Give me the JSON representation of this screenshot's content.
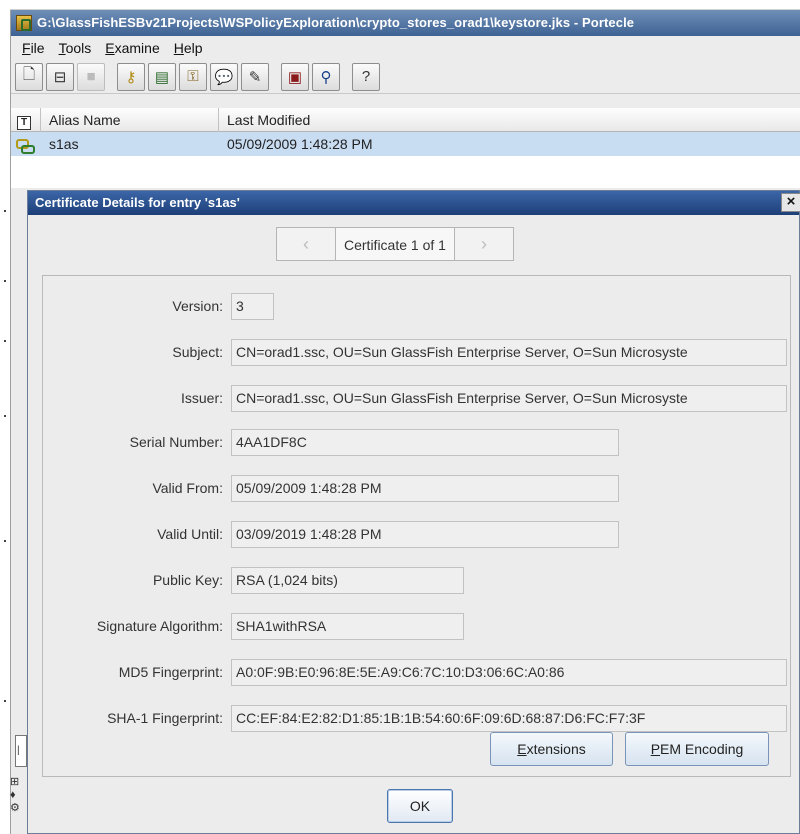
{
  "window": {
    "title": "G:\\GlassFishESBv21Projects\\WSPolicyExploration\\crypto_stores_orad1\\keystore.jks - Portecle"
  },
  "menu": [
    {
      "label": "File",
      "mnemonic": "F",
      "rest": "ile"
    },
    {
      "label": "Tools",
      "mnemonic": "T",
      "rest": "ools"
    },
    {
      "label": "Examine",
      "mnemonic": "E",
      "rest": "xamine"
    },
    {
      "label": "Help",
      "mnemonic": "H",
      "rest": "elp"
    }
  ],
  "toolbar": {
    "icons": [
      "new-keystore-icon",
      "open-keystore-icon",
      "save-keystore-icon",
      "generate-keypair-icon",
      "import-certificate-icon",
      "import-keypair-icon",
      "set-password-icon",
      "keystore-report-icon",
      "examine-certificate-icon",
      "examine-csr-icon",
      "help-icon"
    ]
  },
  "table": {
    "columns": {
      "type_glyph": "T",
      "alias": "Alias Name",
      "modified": "Last Modified"
    },
    "rows": [
      {
        "alias": "s1as",
        "modified": "05/09/2009 1:48:28 PM",
        "icon": "keypair-icon"
      }
    ]
  },
  "dialog": {
    "title": "Certificate Details for entry 's1as'",
    "close": "×",
    "nav": {
      "prev": "‹",
      "label": "Certificate 1 of 1",
      "next": "›"
    },
    "fields": {
      "version": {
        "label": "Version:",
        "value": "3"
      },
      "subject": {
        "label": "Subject:",
        "value": "CN=orad1.ssc, OU=Sun GlassFish Enterprise Server, O=Sun Microsyste"
      },
      "issuer": {
        "label": "Issuer:",
        "value": "CN=orad1.ssc, OU=Sun GlassFish Enterprise Server, O=Sun Microsyste"
      },
      "serial": {
        "label": "Serial Number:",
        "value": "4AA1DF8C"
      },
      "valid_from": {
        "label": "Valid From:",
        "value": "05/09/2009 1:48:28 PM"
      },
      "valid_until": {
        "label": "Valid Until:",
        "value": "03/09/2019 1:48:28 PM"
      },
      "public_key": {
        "label": "Public Key:",
        "value": "RSA (1,024 bits)"
      },
      "sig_alg": {
        "label": "Signature Algorithm:",
        "value": "SHA1withRSA"
      },
      "md5": {
        "label": "MD5 Fingerprint:",
        "value": "A0:0F:9B:E0:96:8E:5E:A9:C6:7C:10:D3:06:6C:A0:86"
      },
      "sha1": {
        "label": "SHA-1 Fingerprint:",
        "value": "CC:EF:84:E2:82:D1:85:1B:1B:54:60:6F:09:6D:68:87:D6:FC:F7:3F"
      }
    },
    "buttons": {
      "extensions": {
        "mnemonic": "E",
        "rest": "xtensions"
      },
      "pem": {
        "mnemonic": "P",
        "rest": "EM Encoding"
      },
      "ok": "OK"
    }
  }
}
